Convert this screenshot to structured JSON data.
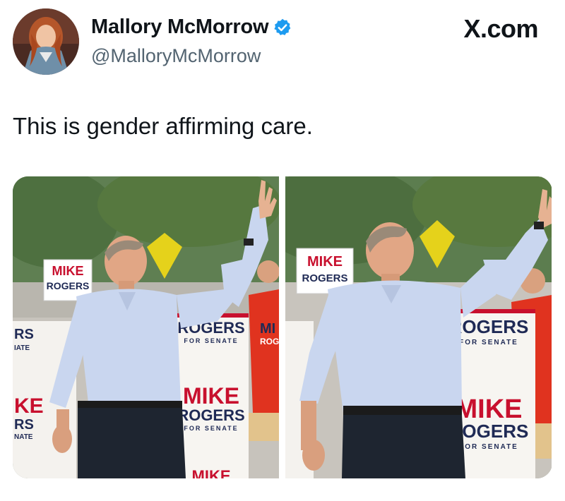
{
  "author": {
    "display_name": "Mallory McMorrow",
    "handle": "@MalloryMcMorrow",
    "verified": true,
    "avatar_icon": "profile-photo"
  },
  "site": {
    "label": "X.com"
  },
  "tweet": {
    "text": "This is gender affirming care."
  },
  "photos": [
    {
      "id": "left",
      "signs": {
        "small_sign": [
          "MIKE",
          "ROGERS"
        ],
        "banner_top": [
          "ROGERS",
          "FOR SENATE"
        ],
        "banner_mid": [
          "MIKE",
          "ROGERS",
          "FOR SENATE"
        ],
        "edge_fragments": [
          "RS",
          "IATE",
          "KE",
          "RS",
          "NATE"
        ],
        "bottom_fragment": "MIKE",
        "shirt_text": [
          "MI",
          "ROG"
        ]
      }
    },
    {
      "id": "right",
      "signs": {
        "small_sign": [
          "MIKE",
          "ROGERS"
        ],
        "banner_top": [
          "ROGERS",
          "FOR SENATE"
        ],
        "banner_mid": [
          "MIKE",
          "ROGERS",
          "FOR SENATE"
        ]
      }
    }
  ],
  "colors": {
    "verified_blue": "#1d9bf0",
    "sign_red": "#c8102e",
    "sign_navy": "#1f2a55",
    "shirt_blue": "#c9d6ef",
    "handle_gray": "#536471"
  }
}
